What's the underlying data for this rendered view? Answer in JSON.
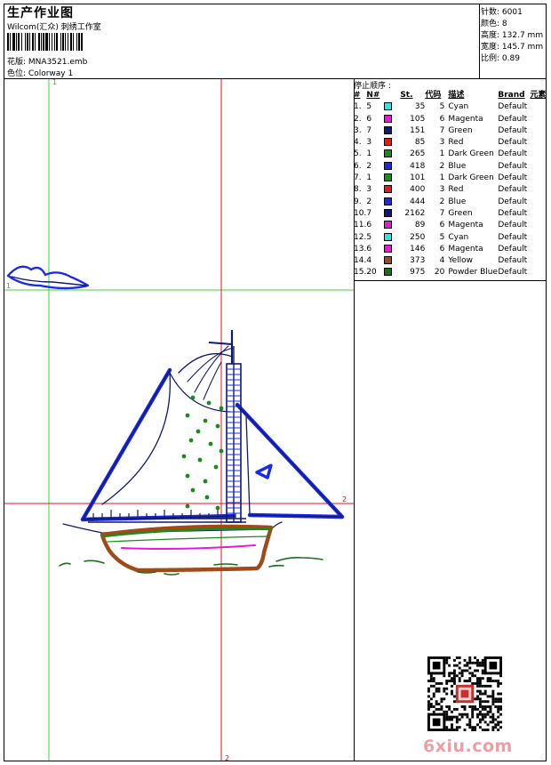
{
  "header": {
    "title": "生产作业图",
    "subtitle": "Wilcom(汇众) 刺绣工作室",
    "design_label": "花版:",
    "design_value": "MNA3521.emb",
    "colorway_label": "色位:",
    "colorway_value": "Colorway 1"
  },
  "specs": [
    {
      "label": "针数:",
      "value": "6001"
    },
    {
      "label": "颜色:",
      "value": "8"
    },
    {
      "label": "高度:",
      "value": "132.7 mm"
    },
    {
      "label": "宽度:",
      "value": "145.7 mm"
    },
    {
      "label": "比例:",
      "value": "0.89"
    }
  ],
  "sequence": {
    "heading": "停止顺序 :",
    "columns": {
      "idx": "#",
      "n": "N#",
      "st": "St.",
      "code": "代码",
      "desc": "描述",
      "brand": "Brand",
      "elem": "元素"
    },
    "rows": [
      {
        "idx": "1.",
        "n": "5",
        "color": "#33e0e8",
        "st": "35",
        "code": "5",
        "desc": "Cyan",
        "brand": "Default"
      },
      {
        "idx": "2.",
        "n": "6",
        "color": "#e81ad8",
        "st": "105",
        "code": "6",
        "desc": "Magenta",
        "brand": "Default"
      },
      {
        "idx": "3.",
        "n": "7",
        "color": "#101a6e",
        "st": "151",
        "code": "7",
        "desc": "Green",
        "brand": "Default"
      },
      {
        "idx": "4.",
        "n": "3",
        "color": "#e81a10",
        "st": "85",
        "code": "3",
        "desc": "Red",
        "brand": "Default"
      },
      {
        "idx": "5.",
        "n": "1",
        "color": "#1a8c1a",
        "st": "265",
        "code": "1",
        "desc": "Dark Green",
        "brand": "Default"
      },
      {
        "idx": "6.",
        "n": "2",
        "color": "#1a2ae8",
        "st": "418",
        "code": "2",
        "desc": "Blue",
        "brand": "Default"
      },
      {
        "idx": "7.",
        "n": "1",
        "color": "#1a8c1a",
        "st": "101",
        "code": "1",
        "desc": "Dark Green",
        "brand": "Default"
      },
      {
        "idx": "8.",
        "n": "3",
        "color": "#e81a10",
        "st": "400",
        "code": "3",
        "desc": "Red",
        "brand": "Default"
      },
      {
        "idx": "9.",
        "n": "2",
        "color": "#1a2ae8",
        "st": "444",
        "code": "2",
        "desc": "Blue",
        "brand": "Default"
      },
      {
        "idx": "10.",
        "n": "7",
        "color": "#101a6e",
        "st": "2162",
        "code": "7",
        "desc": "Green",
        "brand": "Default"
      },
      {
        "idx": "11.",
        "n": "6",
        "color": "#e81ad8",
        "st": "89",
        "code": "6",
        "desc": "Magenta",
        "brand": "Default"
      },
      {
        "idx": "12.",
        "n": "5",
        "color": "#33e0e8",
        "st": "250",
        "code": "5",
        "desc": "Cyan",
        "brand": "Default"
      },
      {
        "idx": "13.",
        "n": "6",
        "color": "#e81ad8",
        "st": "146",
        "code": "6",
        "desc": "Magenta",
        "brand": "Default"
      },
      {
        "idx": "14.",
        "n": "4",
        "color": "#a04a1a",
        "st": "373",
        "code": "4",
        "desc": "Yellow",
        "brand": "Default"
      },
      {
        "idx": "15.",
        "n": "20",
        "color": "#1a6e1a",
        "st": "975",
        "code": "20",
        "desc": "Powder Blue",
        "brand": "Default"
      }
    ]
  },
  "guides": {
    "v1": "1",
    "h1": "1",
    "h2": "2",
    "v2": "2"
  },
  "watermark": "6xiu.com",
  "colors": {
    "guide_green": "#33dd33",
    "guide_red": "#ee1111",
    "thread_navy": "#101a6e",
    "thread_blue": "#1a2ae8"
  }
}
